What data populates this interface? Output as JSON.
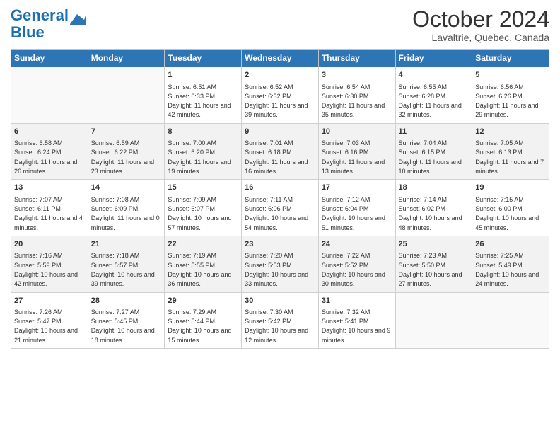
{
  "header": {
    "logo_line1": "General",
    "logo_line2": "Blue",
    "month_title": "October 2024",
    "subtitle": "Lavaltrie, Quebec, Canada"
  },
  "days_of_week": [
    "Sunday",
    "Monday",
    "Tuesday",
    "Wednesday",
    "Thursday",
    "Friday",
    "Saturday"
  ],
  "weeks": [
    [
      {
        "num": "",
        "sunrise": "",
        "sunset": "",
        "daylight": ""
      },
      {
        "num": "",
        "sunrise": "",
        "sunset": "",
        "daylight": ""
      },
      {
        "num": "1",
        "sunrise": "Sunrise: 6:51 AM",
        "sunset": "Sunset: 6:33 PM",
        "daylight": "Daylight: 11 hours and 42 minutes."
      },
      {
        "num": "2",
        "sunrise": "Sunrise: 6:52 AM",
        "sunset": "Sunset: 6:32 PM",
        "daylight": "Daylight: 11 hours and 39 minutes."
      },
      {
        "num": "3",
        "sunrise": "Sunrise: 6:54 AM",
        "sunset": "Sunset: 6:30 PM",
        "daylight": "Daylight: 11 hours and 35 minutes."
      },
      {
        "num": "4",
        "sunrise": "Sunrise: 6:55 AM",
        "sunset": "Sunset: 6:28 PM",
        "daylight": "Daylight: 11 hours and 32 minutes."
      },
      {
        "num": "5",
        "sunrise": "Sunrise: 6:56 AM",
        "sunset": "Sunset: 6:26 PM",
        "daylight": "Daylight: 11 hours and 29 minutes."
      }
    ],
    [
      {
        "num": "6",
        "sunrise": "Sunrise: 6:58 AM",
        "sunset": "Sunset: 6:24 PM",
        "daylight": "Daylight: 11 hours and 26 minutes."
      },
      {
        "num": "7",
        "sunrise": "Sunrise: 6:59 AM",
        "sunset": "Sunset: 6:22 PM",
        "daylight": "Daylight: 11 hours and 23 minutes."
      },
      {
        "num": "8",
        "sunrise": "Sunrise: 7:00 AM",
        "sunset": "Sunset: 6:20 PM",
        "daylight": "Daylight: 11 hours and 19 minutes."
      },
      {
        "num": "9",
        "sunrise": "Sunrise: 7:01 AM",
        "sunset": "Sunset: 6:18 PM",
        "daylight": "Daylight: 11 hours and 16 minutes."
      },
      {
        "num": "10",
        "sunrise": "Sunrise: 7:03 AM",
        "sunset": "Sunset: 6:16 PM",
        "daylight": "Daylight: 11 hours and 13 minutes."
      },
      {
        "num": "11",
        "sunrise": "Sunrise: 7:04 AM",
        "sunset": "Sunset: 6:15 PM",
        "daylight": "Daylight: 11 hours and 10 minutes."
      },
      {
        "num": "12",
        "sunrise": "Sunrise: 7:05 AM",
        "sunset": "Sunset: 6:13 PM",
        "daylight": "Daylight: 11 hours and 7 minutes."
      }
    ],
    [
      {
        "num": "13",
        "sunrise": "Sunrise: 7:07 AM",
        "sunset": "Sunset: 6:11 PM",
        "daylight": "Daylight: 11 hours and 4 minutes."
      },
      {
        "num": "14",
        "sunrise": "Sunrise: 7:08 AM",
        "sunset": "Sunset: 6:09 PM",
        "daylight": "Daylight: 11 hours and 0 minutes."
      },
      {
        "num": "15",
        "sunrise": "Sunrise: 7:09 AM",
        "sunset": "Sunset: 6:07 PM",
        "daylight": "Daylight: 10 hours and 57 minutes."
      },
      {
        "num": "16",
        "sunrise": "Sunrise: 7:11 AM",
        "sunset": "Sunset: 6:06 PM",
        "daylight": "Daylight: 10 hours and 54 minutes."
      },
      {
        "num": "17",
        "sunrise": "Sunrise: 7:12 AM",
        "sunset": "Sunset: 6:04 PM",
        "daylight": "Daylight: 10 hours and 51 minutes."
      },
      {
        "num": "18",
        "sunrise": "Sunrise: 7:14 AM",
        "sunset": "Sunset: 6:02 PM",
        "daylight": "Daylight: 10 hours and 48 minutes."
      },
      {
        "num": "19",
        "sunrise": "Sunrise: 7:15 AM",
        "sunset": "Sunset: 6:00 PM",
        "daylight": "Daylight: 10 hours and 45 minutes."
      }
    ],
    [
      {
        "num": "20",
        "sunrise": "Sunrise: 7:16 AM",
        "sunset": "Sunset: 5:59 PM",
        "daylight": "Daylight: 10 hours and 42 minutes."
      },
      {
        "num": "21",
        "sunrise": "Sunrise: 7:18 AM",
        "sunset": "Sunset: 5:57 PM",
        "daylight": "Daylight: 10 hours and 39 minutes."
      },
      {
        "num": "22",
        "sunrise": "Sunrise: 7:19 AM",
        "sunset": "Sunset: 5:55 PM",
        "daylight": "Daylight: 10 hours and 36 minutes."
      },
      {
        "num": "23",
        "sunrise": "Sunrise: 7:20 AM",
        "sunset": "Sunset: 5:53 PM",
        "daylight": "Daylight: 10 hours and 33 minutes."
      },
      {
        "num": "24",
        "sunrise": "Sunrise: 7:22 AM",
        "sunset": "Sunset: 5:52 PM",
        "daylight": "Daylight: 10 hours and 30 minutes."
      },
      {
        "num": "25",
        "sunrise": "Sunrise: 7:23 AM",
        "sunset": "Sunset: 5:50 PM",
        "daylight": "Daylight: 10 hours and 27 minutes."
      },
      {
        "num": "26",
        "sunrise": "Sunrise: 7:25 AM",
        "sunset": "Sunset: 5:49 PM",
        "daylight": "Daylight: 10 hours and 24 minutes."
      }
    ],
    [
      {
        "num": "27",
        "sunrise": "Sunrise: 7:26 AM",
        "sunset": "Sunset: 5:47 PM",
        "daylight": "Daylight: 10 hours and 21 minutes."
      },
      {
        "num": "28",
        "sunrise": "Sunrise: 7:27 AM",
        "sunset": "Sunset: 5:45 PM",
        "daylight": "Daylight: 10 hours and 18 minutes."
      },
      {
        "num": "29",
        "sunrise": "Sunrise: 7:29 AM",
        "sunset": "Sunset: 5:44 PM",
        "daylight": "Daylight: 10 hours and 15 minutes."
      },
      {
        "num": "30",
        "sunrise": "Sunrise: 7:30 AM",
        "sunset": "Sunset: 5:42 PM",
        "daylight": "Daylight: 10 hours and 12 minutes."
      },
      {
        "num": "31",
        "sunrise": "Sunrise: 7:32 AM",
        "sunset": "Sunset: 5:41 PM",
        "daylight": "Daylight: 10 hours and 9 minutes."
      },
      {
        "num": "",
        "sunrise": "",
        "sunset": "",
        "daylight": ""
      },
      {
        "num": "",
        "sunrise": "",
        "sunset": "",
        "daylight": ""
      }
    ]
  ]
}
